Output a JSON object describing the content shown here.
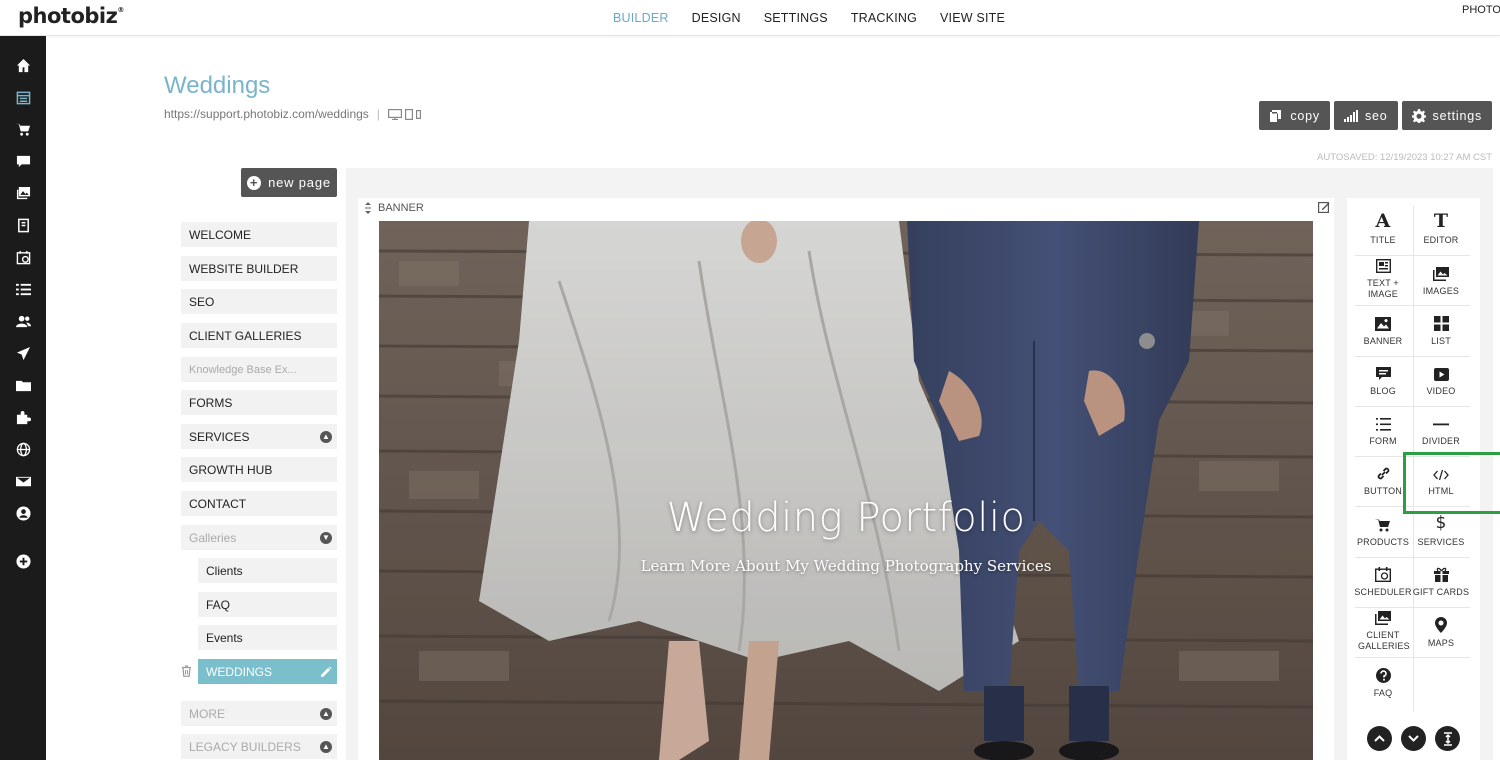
{
  "app": {
    "logo": "photobiz",
    "top_right": "PHOTO"
  },
  "topnav": [
    "BUILDER",
    "DESIGN",
    "SETTINGS",
    "TRACKING",
    "VIEW SITE"
  ],
  "sidebar_icons": [
    "home-icon",
    "calendar-icon",
    "cart-icon",
    "chat-icon",
    "gallery-icon",
    "book-icon",
    "scheduler-icon",
    "list-icon",
    "users-icon",
    "send-icon",
    "folder-icon",
    "puzzle-icon",
    "globe-icon",
    "mail-icon",
    "account-icon",
    "add-icon"
  ],
  "page": {
    "title": "Weddings",
    "url": "https://support.photobiz.com/weddings",
    "url_separator": "|"
  },
  "actions": {
    "copy": "copy",
    "seo": "seo",
    "settings": "settings"
  },
  "autosaved": "AUTOSAVED: 12/19/2023 10:27 AM CST",
  "new_page": "new page",
  "pages": [
    {
      "label": "WELCOME"
    },
    {
      "label": "WEBSITE BUILDER"
    },
    {
      "label": "SEO"
    },
    {
      "label": "CLIENT GALLERIES"
    },
    {
      "label": "Knowledge Base Ex..."
    },
    {
      "label": "FORMS"
    },
    {
      "label": "SERVICES"
    },
    {
      "label": "GROWTH HUB"
    },
    {
      "label": "CONTACT"
    },
    {
      "label": "Galleries"
    },
    {
      "label": "Clients"
    },
    {
      "label": "FAQ"
    },
    {
      "label": "Events"
    },
    {
      "label": "WEDDINGS"
    },
    {
      "label": "MORE"
    },
    {
      "label": "LEGACY BUILDERS"
    }
  ],
  "banner": {
    "block_label": "BANNER",
    "title": "Wedding Portfolio",
    "subtitle": "Learn More About My Wedding Photography Services"
  },
  "widgets": {
    "title": "TITLE",
    "editor": "EDITOR",
    "text_image": "TEXT + IMAGE",
    "images": "IMAGES",
    "banner": "BANNER",
    "list": "LIST",
    "blog": "BLOG",
    "video": "VIDEO",
    "form": "FORM",
    "divider": "DIVIDER",
    "button": "BUTTON",
    "html": "HTML",
    "products": "PRODUCTS",
    "services": "SERVICES",
    "scheduler": "SCHEDULER",
    "gift_cards": "GIFT CARDS",
    "client_galleries": "CLIENT GALLERIES",
    "maps": "MAPS",
    "faq": "FAQ"
  },
  "colors": {
    "accent": "#7ab4cc",
    "active_page": "#7bbfcd",
    "sidebar": "#1b1b1b",
    "highlight": "#2e9e45",
    "button": "#555555"
  }
}
